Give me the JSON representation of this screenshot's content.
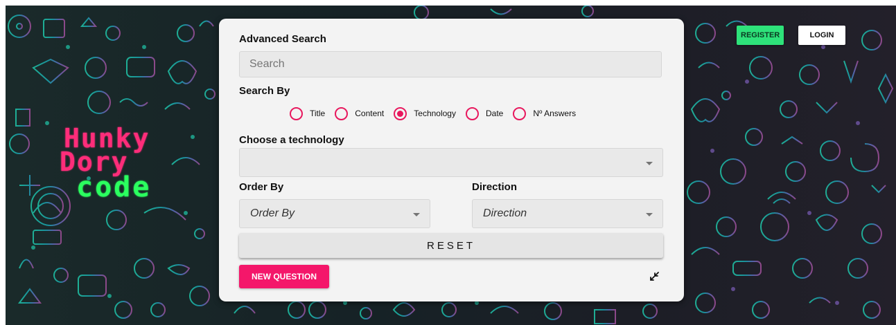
{
  "header": {
    "register_label": "REGISTER",
    "login_label": "LOGIN"
  },
  "logo": {
    "line1": "Hunky",
    "line2": "Dory",
    "line3": "code"
  },
  "search_panel": {
    "title": "Advanced Search",
    "search_input": {
      "placeholder": "Search",
      "value": ""
    },
    "search_by_label": "Search By",
    "search_by_options": [
      {
        "label": "Title",
        "selected": false
      },
      {
        "label": "Content",
        "selected": false
      },
      {
        "label": "Technology",
        "selected": true
      },
      {
        "label": "Date",
        "selected": false
      },
      {
        "label": "Nº Answers",
        "selected": false
      }
    ],
    "technology_label": "Choose a technology",
    "technology_value": "",
    "order_by_label": "Order By",
    "order_by_value": "Order By",
    "direction_label": "Direction",
    "direction_value": "Direction",
    "reset_label": "RESET",
    "new_question_label": "NEW QUESTION",
    "collapse_icon": "collapse-arrows-icon"
  },
  "colors": {
    "accent": "#e8175d",
    "register": "#2ee27a",
    "new_question": "#f4176a"
  }
}
